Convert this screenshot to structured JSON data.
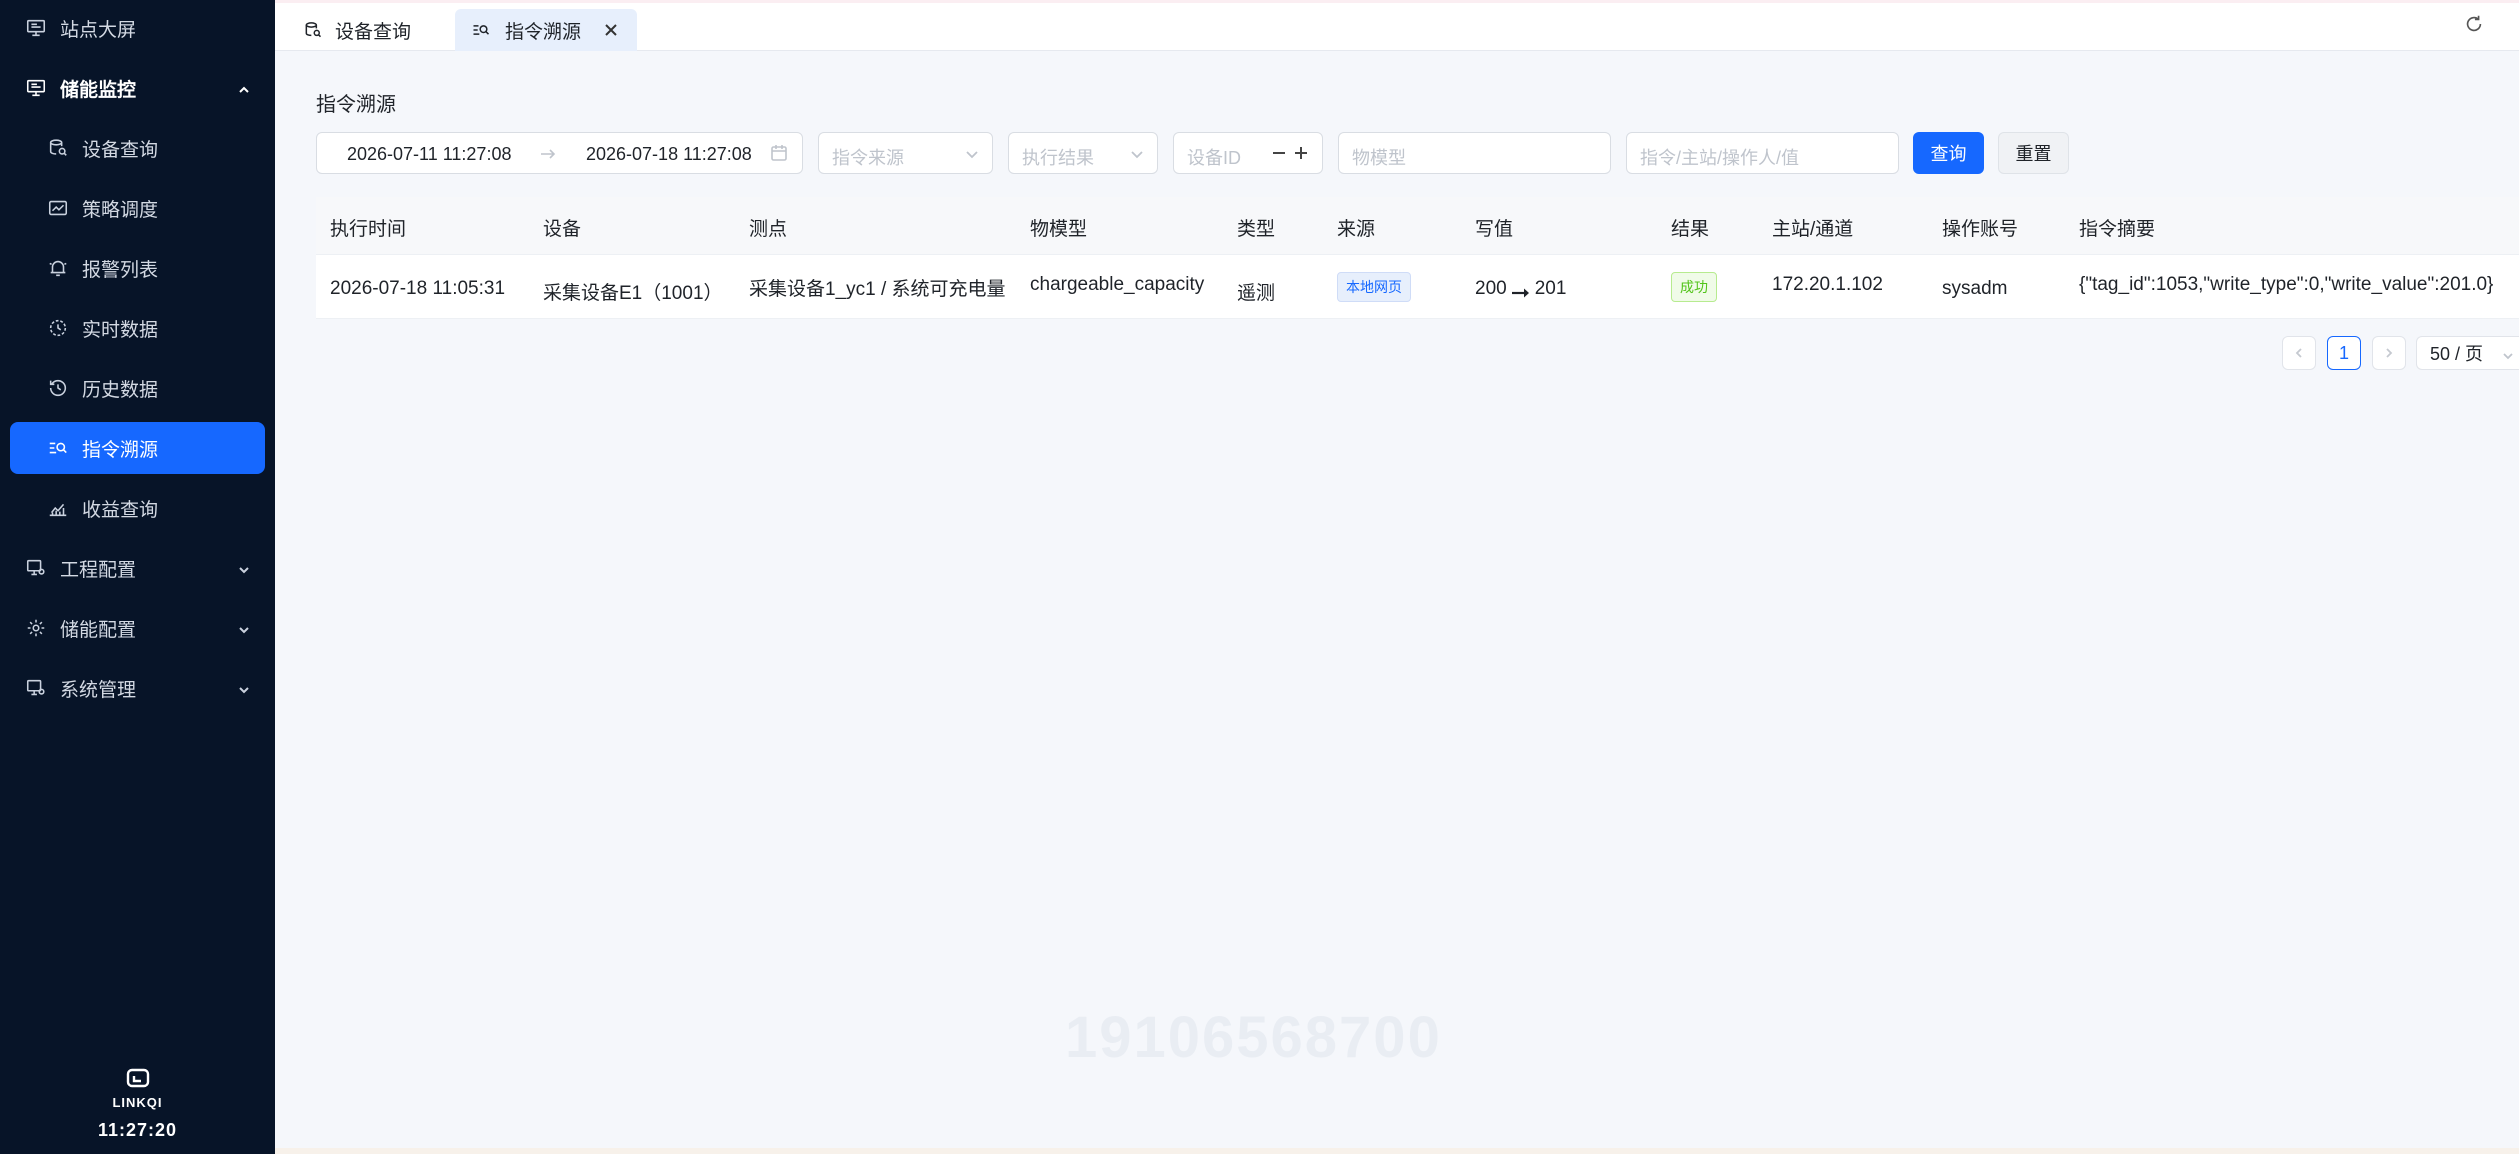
{
  "sidebar": {
    "items": [
      {
        "label": "站点大屏"
      },
      {
        "label": "储能监控"
      },
      {
        "label": "设备查询"
      },
      {
        "label": "策略调度"
      },
      {
        "label": "报警列表"
      },
      {
        "label": "实时数据"
      },
      {
        "label": "历史数据"
      },
      {
        "label": "指令溯源"
      },
      {
        "label": "收益查询"
      },
      {
        "label": "工程配置"
      },
      {
        "label": "储能配置"
      },
      {
        "label": "系统管理"
      }
    ],
    "brand": "LINKQI",
    "clock": "11:27:20",
    "active_color": "#1668ff"
  },
  "tabs": [
    {
      "label": "设备查询"
    },
    {
      "label": "指令溯源"
    }
  ],
  "page": {
    "title": "指令溯源"
  },
  "filters": {
    "start_date": "2026-07-11 11:27:08",
    "end_date": "2026-07-18 11:27:08",
    "source_placeholder": "指令来源",
    "result_placeholder": "执行结果",
    "device_id_placeholder": "设备ID",
    "model_placeholder": "物模型",
    "keyword_placeholder": "指令/主站/操作人/值",
    "query_label": "查询",
    "reset_label": "重置"
  },
  "table": {
    "columns": [
      "执行时间",
      "设备",
      "测点",
      "物模型",
      "类型",
      "来源",
      "写值",
      "结果",
      "主站/通道",
      "操作账号",
      "指令摘要"
    ],
    "rows": [
      {
        "time": "2026-07-18 11:05:31",
        "device": "采集设备E1（1001）",
        "point": "采集设备1_yc1 / 系统可充电量",
        "model": "chargeable_capacity",
        "type": "遥测",
        "source": "本地网页",
        "write_from": "200",
        "write_to": "201",
        "result": "成功",
        "channel": "172.20.1.102",
        "account": "sysadm",
        "summary": "{\"tag_id\":1053,\"write_type\":0,\"write_value\":201.0}"
      }
    ]
  },
  "pagination": {
    "current_page": "1",
    "page_size": "50 / 页"
  },
  "watermark": "19106568700"
}
